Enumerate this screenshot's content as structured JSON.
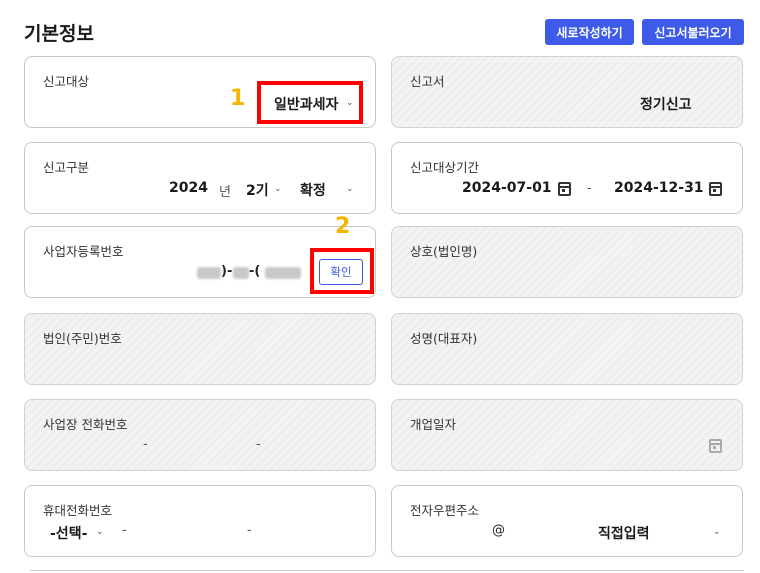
{
  "page": {
    "title": "기본정보"
  },
  "buttons": {
    "new_label": "새로작성하기",
    "load_label": "신고서불러오기"
  },
  "fields": {
    "report_target": {
      "label": "신고대상",
      "value": "일반과세자"
    },
    "report_form": {
      "label": "신고서",
      "value": "정기신고"
    },
    "report_type": {
      "label": "신고구분",
      "year": "2024",
      "year_unit": "년",
      "period": "2기",
      "status": "확정"
    },
    "report_period": {
      "label": "신고대상기간",
      "start": "2024-07-01",
      "sep": "-",
      "end": "2024-12-31"
    },
    "business_reg_no": {
      "label": "사업자등록번호",
      "sep1": ")-",
      "sep2": "-(",
      "confirm": "확인"
    },
    "company_name": {
      "label": "상호(법인명)"
    },
    "corp_no": {
      "label": "법인(주민)번호"
    },
    "representative": {
      "label": "성명(대표자)"
    },
    "business_phone": {
      "label": "사업장 전화번호",
      "sep1": "-",
      "sep2": "-"
    },
    "open_date": {
      "label": "개업일자"
    },
    "mobile": {
      "label": "휴대전화번호",
      "select": "-선택-",
      "sep1": "-",
      "sep2": "-"
    },
    "email": {
      "label": "전자우편주소",
      "at": "@",
      "domain_select": "직접입력"
    }
  },
  "annotations": {
    "one": "1",
    "two": "2"
  },
  "icons": {
    "chevron": "chevron-down-icon",
    "calendar": "calendar-icon"
  },
  "colors": {
    "primary": "#3d5ae8",
    "highlight": "#ff0000",
    "annotation": "#f5b400"
  }
}
